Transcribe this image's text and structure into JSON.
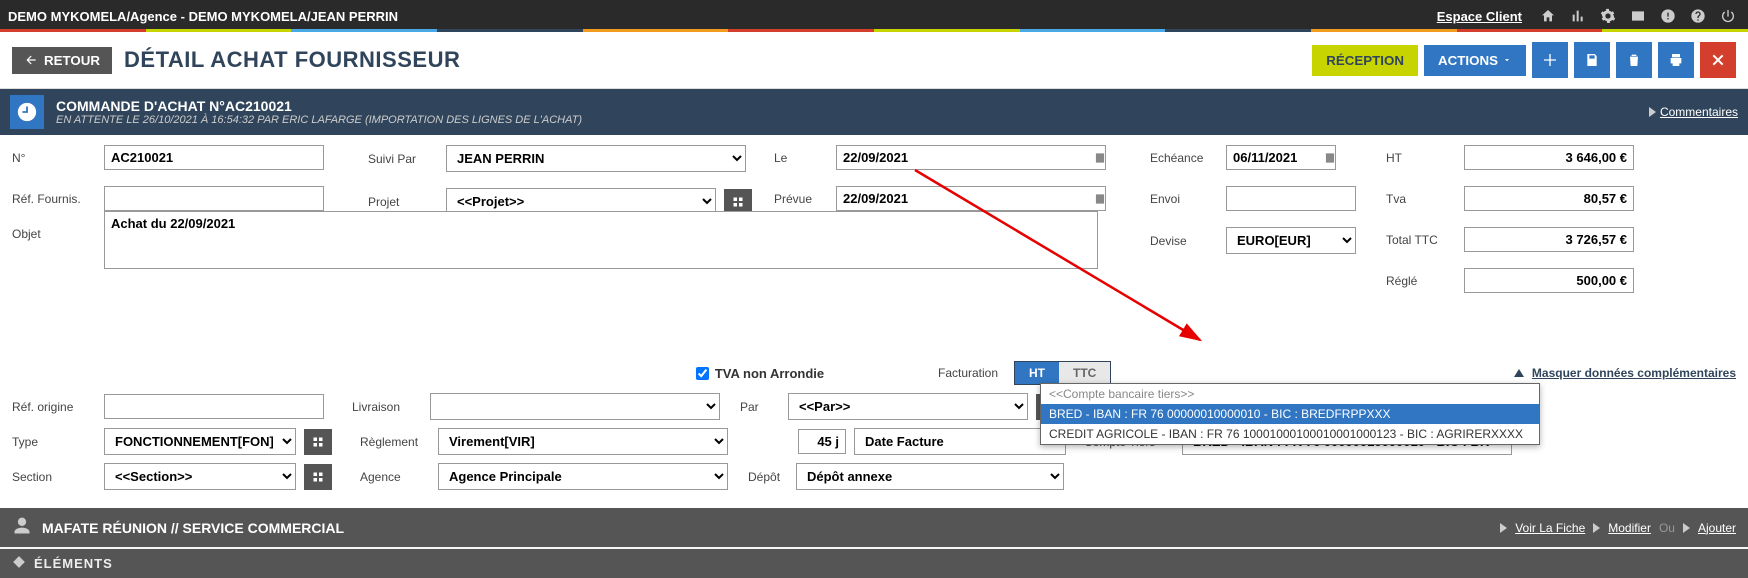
{
  "topbar": {
    "breadcrumb": "DEMO MYKOMELA/Agence - DEMO MYKOMELA/JEAN PERRIN",
    "espace_client": "Espace Client"
  },
  "header": {
    "retour": "RETOUR",
    "title": "DÉTAIL ACHAT FOURNISSEUR",
    "reception": "RÉCEPTION",
    "actions": "ACTIONS"
  },
  "info": {
    "title": "COMMANDE D'ACHAT N°AC210021",
    "sub": "EN ATTENTE LE 26/10/2021 À 16:54:32 PAR ERIC LAFARGE (IMPORTATION DES LIGNES DE L'ACHAT)",
    "comments": "Commentaires"
  },
  "labels": {
    "no": "N°",
    "ref_fournis": "Réf. Fournis.",
    "objet": "Objet",
    "suivi_par": "Suivi Par",
    "projet": "Projet",
    "le": "Le",
    "prevue": "Prévue",
    "echeance": "Echéance",
    "envoi": "Envoi",
    "devise": "Devise",
    "facturation": "Facturation",
    "ht_label": "HT",
    "tva_label": "Tva",
    "total_ttc": "Total TTC",
    "regle": "Réglé",
    "tva_non_arrondie": "TVA non Arrondie",
    "ht": "HT",
    "ttc": "TTC",
    "masquer": "Masquer données complémentaires",
    "ref_origine": "Réf. origine",
    "livraison": "Livraison",
    "par": "Par",
    "type": "Type",
    "reglement": "Règlement",
    "compte_tiers": "Compte Tiers",
    "section": "Section",
    "agence": "Agence",
    "depot": "Dépôt",
    "jours": "45 j"
  },
  "values": {
    "no": "AC210021",
    "ref_fournis": "",
    "objet": "Achat du 22/09/2021",
    "suivi_par": "JEAN PERRIN",
    "projet": "<<Projet>>",
    "le": "22/09/2021",
    "prevue": "22/09/2021",
    "echeance": "06/11/2021",
    "envoi": "",
    "devise": "EURO[EUR]",
    "ht": "3 646,00 €",
    "tva": "80,57 €",
    "total_ttc": "3 726,57 €",
    "regle": "500,00 €",
    "ref_origine": "",
    "livraison": "",
    "par": "<<Par>>",
    "type": "FONCTIONNEMENT[FON]",
    "reglement": "Virement[VIR]",
    "date_facture": "Date Facture",
    "compte_tiers": "BRED - IBAN : FR 76 00000010000010 - BIC : BRE",
    "section": "<<Section>>",
    "agence": "Agence Principale",
    "depot": "Dépôt annexe"
  },
  "dropdown": {
    "placeholder": "<<Compte bancaire tiers>>",
    "opt1": "BRED - IBAN : FR 76 00000010000010 - BIC : BREDFRPPXXX",
    "opt2": "CREDIT AGRICOLE - IBAN : FR 76 10001000100010001000123 - BIC : AGRIRERXXXX"
  },
  "footer": {
    "title": "MAFATE RÉUNION // SERVICE COMMERCIAL",
    "voir": "Voir La Fiche",
    "modifier": "Modifier",
    "ou": "Ou",
    "ajouter": "Ajouter"
  },
  "elements": "ÉLÉMENTS",
  "accent_colors": [
    "#d43f2d",
    "#c8d400",
    "#48a9e6",
    "#30455b",
    "#f29c1f",
    "#d43f2d",
    "#c8d400",
    "#48a9e6",
    "#30455b",
    "#f29c1f",
    "#d43f2d",
    "#c8d400"
  ]
}
